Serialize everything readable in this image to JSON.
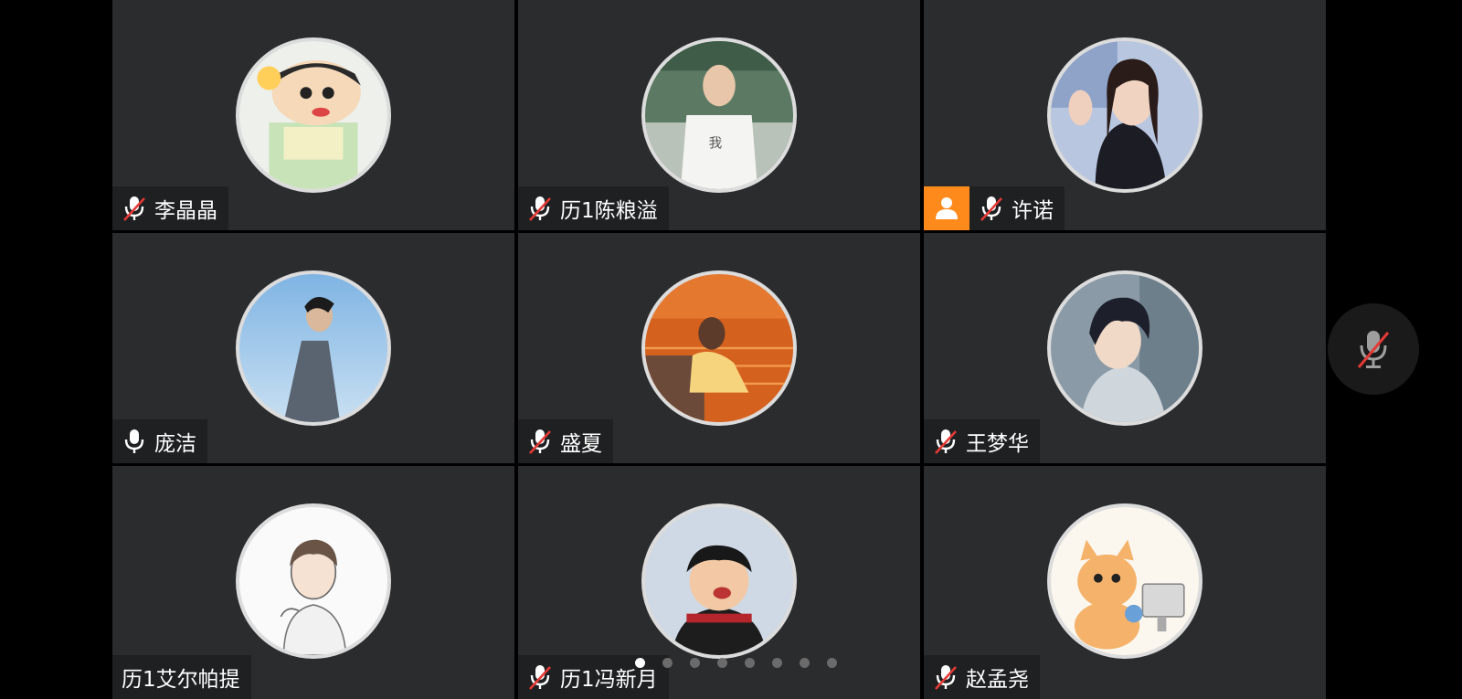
{
  "participants": [
    {
      "name": "李晶晶",
      "mic": "muted",
      "avatar": "cartoon-boy-avatar"
    },
    {
      "name": "历1陈粮溢",
      "mic": "muted",
      "avatar": "man-photo-avatar"
    },
    {
      "name": "许诺",
      "mic": "muted",
      "avatar": "woman-photo-avatar",
      "host": true
    },
    {
      "name": "庞洁",
      "mic": "on",
      "avatar": "sky-portrait-avatar"
    },
    {
      "name": "盛夏",
      "mic": "muted",
      "avatar": "sunset-girl-avatar"
    },
    {
      "name": "王梦华",
      "mic": "muted",
      "avatar": "anime-boy-avatar"
    },
    {
      "name": "历1艾尔帕提",
      "mic": "none",
      "avatar": "sketch-boy-avatar"
    },
    {
      "name": "历1冯新月",
      "mic": "muted",
      "avatar": "child-photo-avatar"
    },
    {
      "name": "赵孟尧",
      "mic": "muted",
      "avatar": "cat-cartoon-avatar"
    }
  ],
  "self_mic": "muted",
  "pagination": {
    "total": 8,
    "current": 1
  },
  "colors": {
    "tile_bg": "#2b2c2e",
    "namebar_bg": "#1f2022",
    "host_badge": "#ff8a1c",
    "muted_slash": "#e53935",
    "mic_icon": "#ffffff"
  }
}
